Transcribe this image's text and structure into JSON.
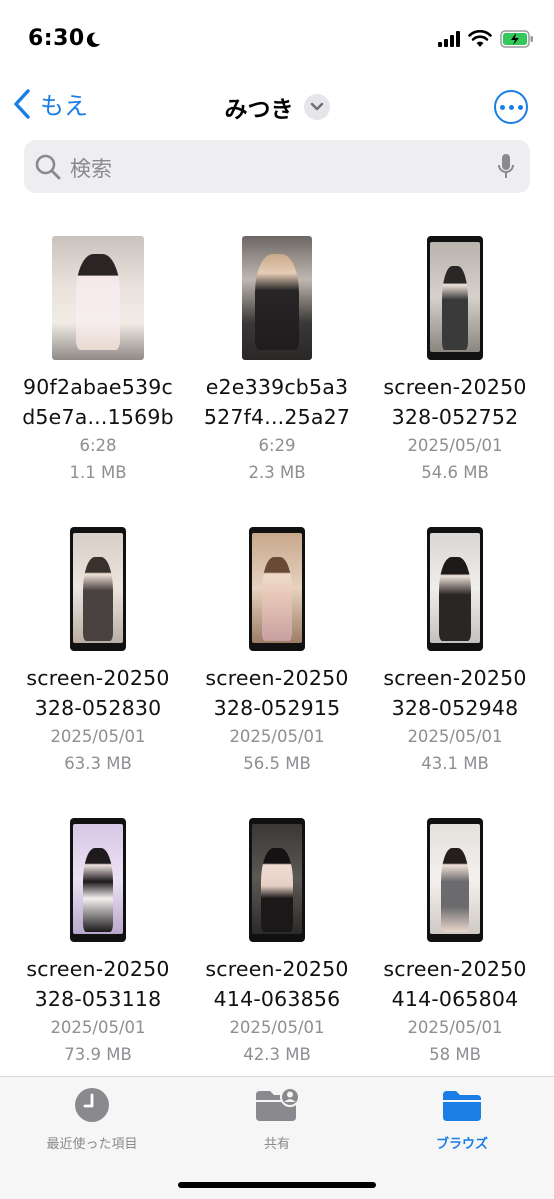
{
  "status_bar": {
    "time": "6:30"
  },
  "nav": {
    "back_label": "もえ",
    "title": "みつき"
  },
  "search": {
    "placeholder": "検索"
  },
  "files": [
    {
      "name_line1": "90f2abae539c",
      "name_line2": "d5e7a...1569b",
      "date": "6:28",
      "size": "1.1 MB"
    },
    {
      "name_line1": "e2e339cb5a3",
      "name_line2": "527f4...25a27",
      "date": "6:29",
      "size": "2.3 MB"
    },
    {
      "name_line1": "screen-20250",
      "name_line2": "328-052752",
      "date": "2025/05/01",
      "size": "54.6 MB"
    },
    {
      "name_line1": "screen-20250",
      "name_line2": "328-052830",
      "date": "2025/05/01",
      "size": "63.3 MB"
    },
    {
      "name_line1": "screen-20250",
      "name_line2": "328-052915",
      "date": "2025/05/01",
      "size": "56.5 MB"
    },
    {
      "name_line1": "screen-20250",
      "name_line2": "328-052948",
      "date": "2025/05/01",
      "size": "43.1 MB"
    },
    {
      "name_line1": "screen-20250",
      "name_line2": "328-053118",
      "date": "2025/05/01",
      "size": "73.9 MB"
    },
    {
      "name_line1": "screen-20250",
      "name_line2": "414-063856",
      "date": "2025/05/01",
      "size": "42.3 MB"
    },
    {
      "name_line1": "screen-20250",
      "name_line2": "414-065804",
      "date": "2025/05/01",
      "size": "58 MB"
    }
  ],
  "tabs": [
    {
      "label": "最近使った項目",
      "icon": "clock-icon",
      "active": false
    },
    {
      "label": "共有",
      "icon": "shared-folder-icon",
      "active": false
    },
    {
      "label": "ブラウズ",
      "icon": "folder-icon",
      "active": true
    }
  ],
  "colors": {
    "accent": "#1a7ee6",
    "secondary_text": "#8e8e93"
  }
}
